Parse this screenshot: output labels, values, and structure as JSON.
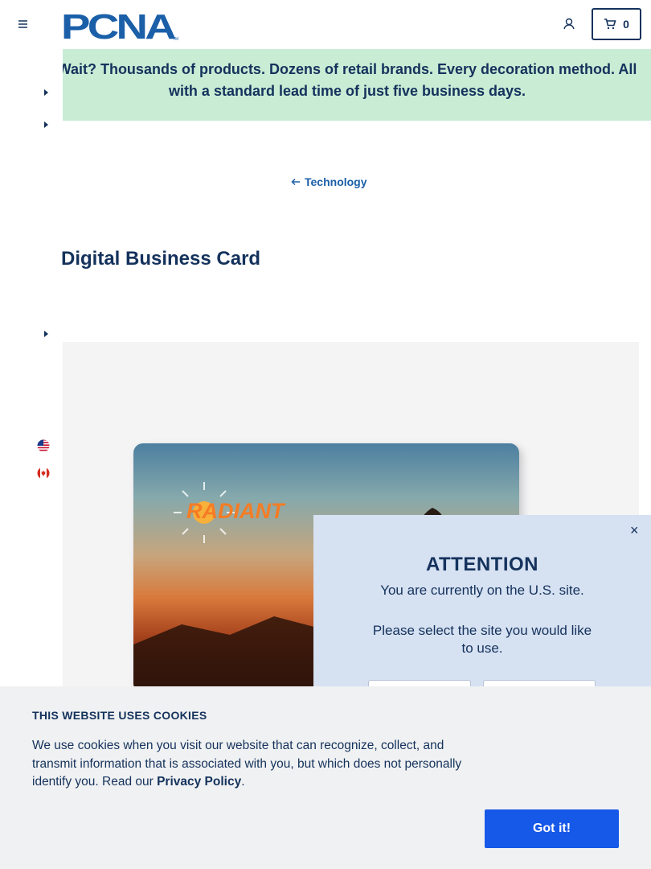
{
  "header": {
    "logo_text": "PCNA",
    "cart_count": "0"
  },
  "promo": {
    "text": "Wait? Thousands of products. Dozens of retail brands. Every decoration method. All with a standard lead time of just five business days."
  },
  "breadcrumb": {
    "label": "Technology"
  },
  "product": {
    "title": "Digital Business Card",
    "card_brand": "RADIANT"
  },
  "modal": {
    "close": "×",
    "heading": "ATTENTION",
    "current_site": "You are currently on the U.S. site.",
    "prompt": "Please select the site you would like to use."
  },
  "cookie": {
    "title": "THIS WEBSITE USES COOKIES",
    "text": "We use cookies when you visit our website that can recognize, collect, and transmit information that is associated with you, but which does not personally identify you. Read our ",
    "link": "Privacy Policy",
    "text_end": ".",
    "button": "Got it!"
  },
  "colors": {
    "brand_navy": "#14325c",
    "link_blue": "#1a5fa8",
    "promo_bg": "#c9ecd5",
    "modal_bg": "#d6e1f2",
    "accept_button": "#1658e8"
  }
}
